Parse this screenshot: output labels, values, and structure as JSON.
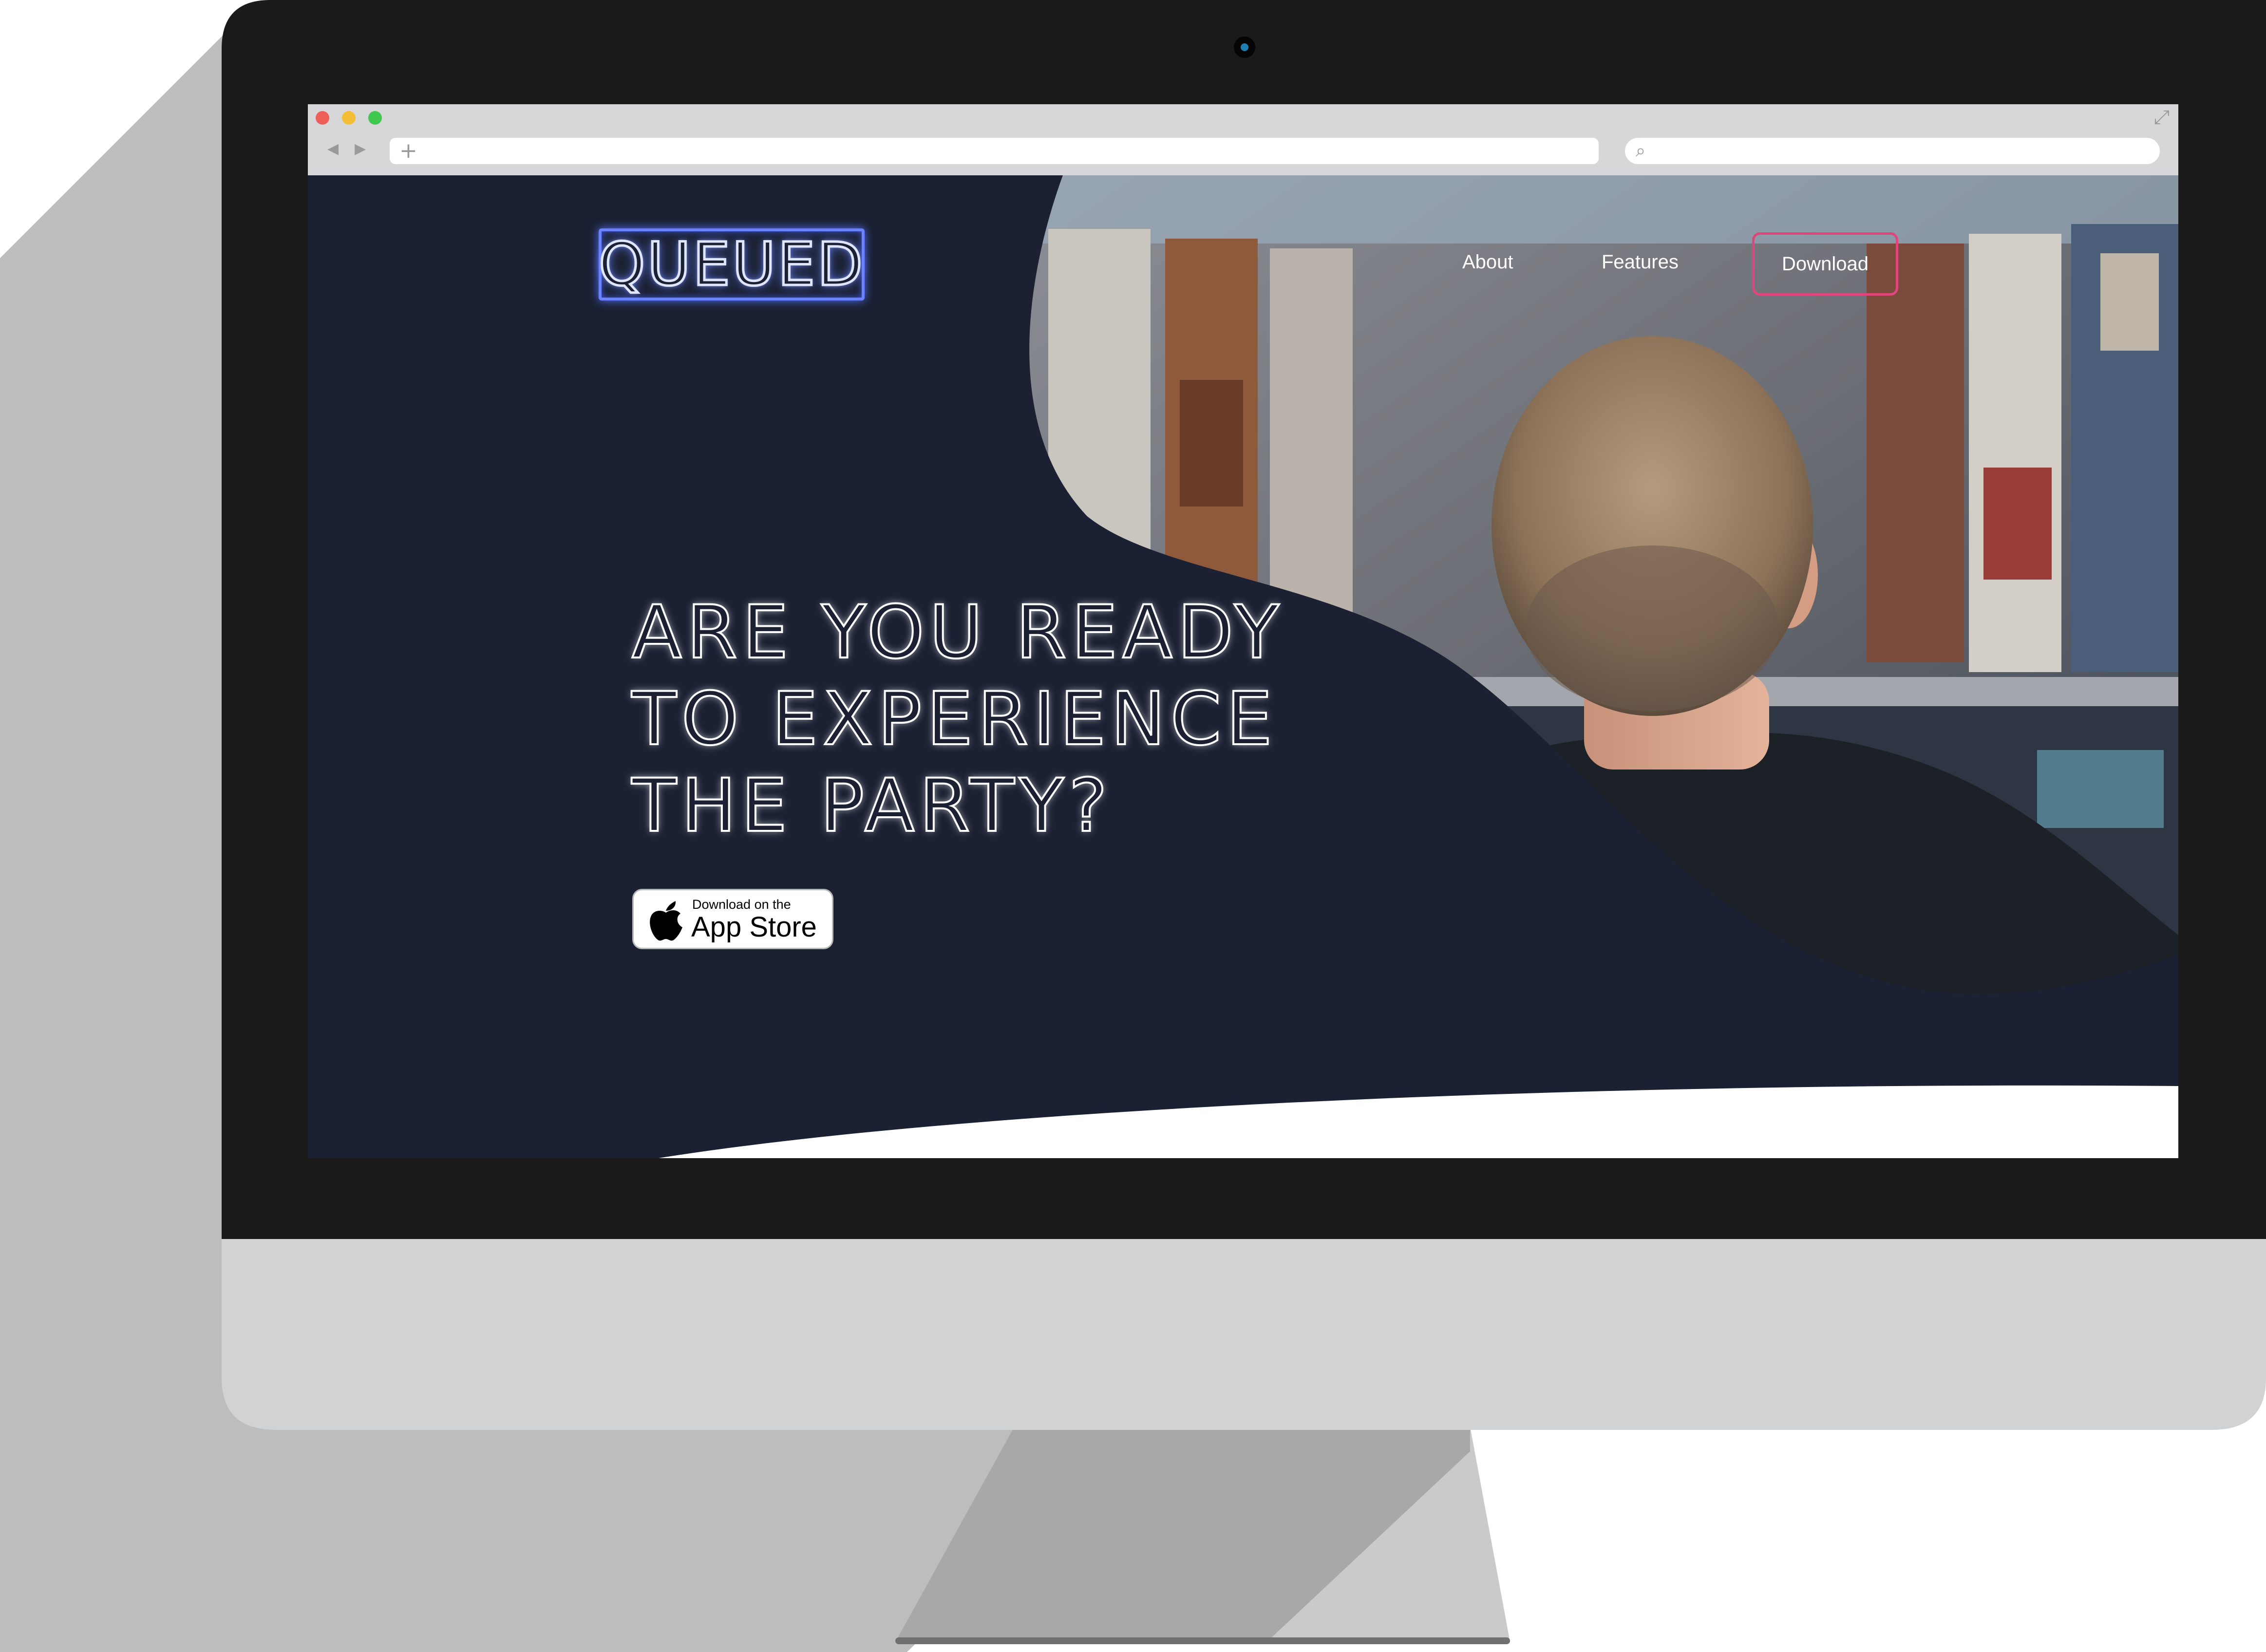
{
  "browser": {
    "back_glyph": "◀",
    "forward_glyph": "▶",
    "new_tab_glyph": "+",
    "search_glyph": "⌕",
    "expand_glyph": "⤢",
    "traffic_lights": [
      "#ed5f57",
      "#f3be35",
      "#3fc84d"
    ]
  },
  "site": {
    "logo": "QUEUED",
    "nav": {
      "about": "About",
      "features": "Features",
      "download": "Download"
    },
    "hero": {
      "heading": "ARE YOU READY\nTO EXPERIENCE\nTHE PARTY?"
    },
    "app_store_badge": {
      "small_text": "Download on the",
      "large_text": "App Store"
    }
  },
  "colors": {
    "page_background": "#1b2133",
    "logo_neon": "#6b82ff",
    "download_border": "#e0467b",
    "monitor_bezel": "#1a1a1a",
    "monitor_chin": "#d1d2d4"
  },
  "icons": [
    "apple-icon",
    "search-icon",
    "expand-icon",
    "back-arrow-icon",
    "forward-arrow-icon",
    "plus-icon"
  ]
}
